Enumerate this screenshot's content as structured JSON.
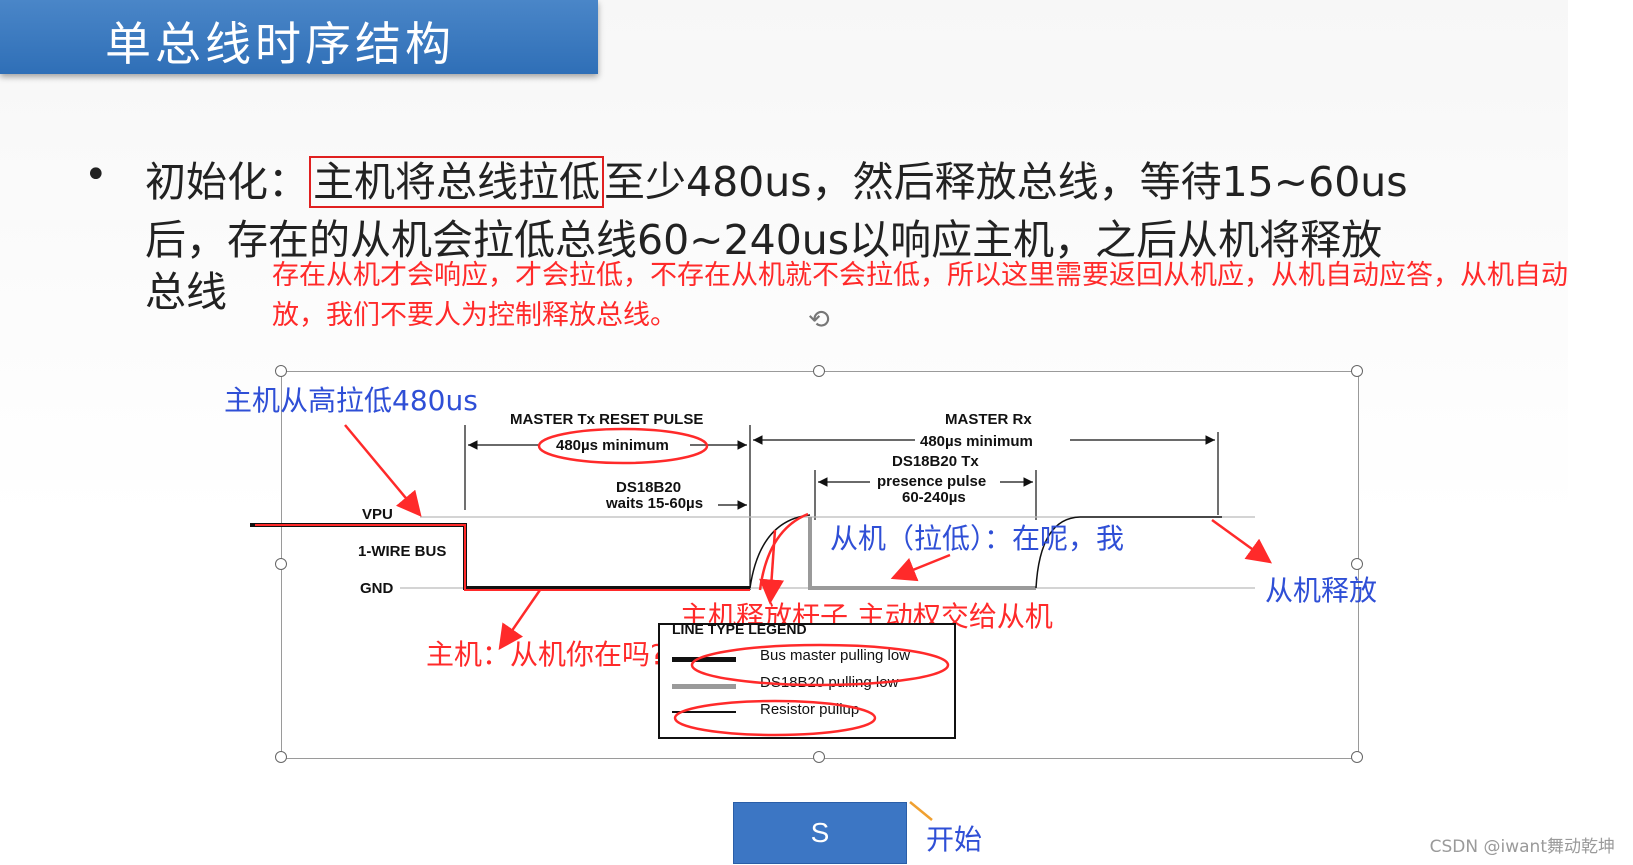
{
  "title": "单总线时序结构",
  "bullet": {
    "line1_a": "初始化：",
    "line1_boxed": "主机将总线拉低",
    "line1_b": "至少480us，然后释放总线，等待15~60us",
    "line2": "后，存在的从机会拉低总线60~240us以响应主机，之后从机将释放",
    "line3": "总线"
  },
  "red_note": "存在从机才会响应，才会拉低，不存在从机就不会拉低，所以这里需要返回从机应，从机自动应答，从机自动释放，我们不要人为控制释放总线。",
  "diagram": {
    "master_tx": "MASTER Tx RESET PULSE",
    "min480": "480µs minimum",
    "ds_waits_1": "DS18B20",
    "ds_waits_2": "waits 15-60µs",
    "master_rx": "MASTER Rx",
    "rx_min": "480µs minimum",
    "ds_tx": "DS18B20 Tx",
    "presence": "presence pulse",
    "presence_range": "60-240µs",
    "vpu": "VPU",
    "bus": "1-WIRE BUS",
    "gnd": "GND"
  },
  "legend": {
    "title": "LINE TYPE LEGEND",
    "items": [
      {
        "label": "Bus master pulling low",
        "color": "#111111"
      },
      {
        "label": "DS18B20 pulling low",
        "color": "#9a9a9a"
      },
      {
        "label": "Resistor pullup",
        "color": "#111111"
      }
    ]
  },
  "annotations": {
    "master_pull": "主机从高拉低480us",
    "slave_pull": "从机（拉低）：在呢，我",
    "slave_release": "从机释放",
    "master_release": "主机释放杆子 主动权交给从机",
    "master_ask": "主机：从机你在吗?"
  },
  "controls": {
    "start_button": "S",
    "start_label": "开始"
  },
  "watermark": "CSDN @iwant舞动乾坤",
  "colors": {
    "title_bar": "#2f6fb7",
    "annotation_red": "#ff2a2a",
    "annotation_blue": "#2f4fd6"
  }
}
